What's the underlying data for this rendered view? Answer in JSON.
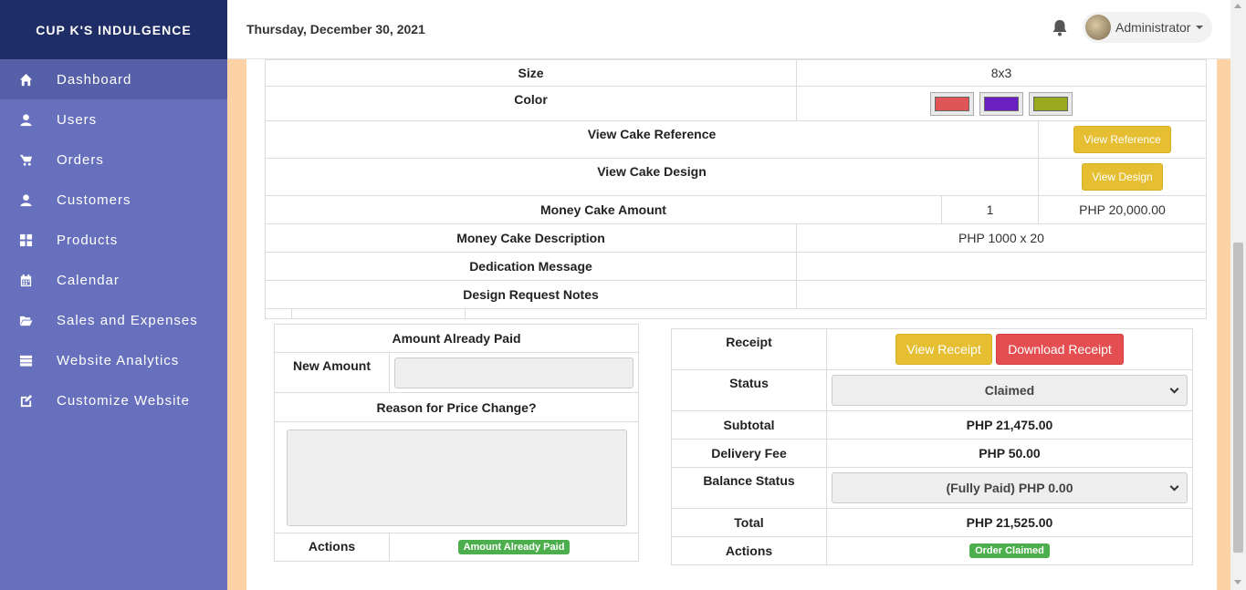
{
  "brand": "CUP K'S INDULGENCE",
  "sidebar": {
    "items": [
      {
        "label": "Dashboard",
        "icon": "home-icon"
      },
      {
        "label": "Users",
        "icon": "user-icon"
      },
      {
        "label": "Orders",
        "icon": "cart-icon"
      },
      {
        "label": "Customers",
        "icon": "user-icon"
      },
      {
        "label": "Products",
        "icon": "grid-icon"
      },
      {
        "label": "Calendar",
        "icon": "calendar-icon"
      },
      {
        "label": "Sales and Expenses",
        "icon": "folder-open-icon"
      },
      {
        "label": "Website Analytics",
        "icon": "server-icon"
      },
      {
        "label": "Customize Website",
        "icon": "edit-icon"
      }
    ]
  },
  "topbar": {
    "date": "Thursday, December 30, 2021",
    "user": "Administrator"
  },
  "details": {
    "size_label": "Size",
    "size_value": "8x3",
    "color_label": "Color",
    "colors": [
      "#e05555",
      "#6a1fc2",
      "#9aaa1e"
    ],
    "reference_label": "View Cake Reference",
    "reference_button": "View Reference",
    "design_label": "View Cake Design",
    "design_button": "View Design",
    "money_amount_label": "Money Cake Amount",
    "money_amount_qty": "1",
    "money_amount_value": "PHP 20,000.00",
    "money_desc_label": "Money Cake Description",
    "money_desc_value": "PHP 1000 x 20",
    "dedication_label": "Dedication Message",
    "dedication_value": "",
    "notes_label": "Design Request Notes",
    "notes_value": ""
  },
  "price_change": {
    "title": "Amount Already Paid",
    "new_amount_label": "New Amount",
    "new_amount_value": "",
    "reason_label": "Reason for Price Change?",
    "reason_value": "",
    "actions_label": "Actions",
    "actions_badge": "Amount Already Paid"
  },
  "summary": {
    "receipt_label": "Receipt",
    "view_receipt": "View Receipt",
    "download_receipt": "Download Receipt",
    "status_label": "Status",
    "status_value": "Claimed",
    "subtotal_label": "Subtotal",
    "subtotal_value": "PHP 21,475.00",
    "delivery_label": "Delivery Fee",
    "delivery_value": "PHP 50.00",
    "balance_label": "Balance Status",
    "balance_value": "(Fully Paid) PHP 0.00",
    "total_label": "Total",
    "total_value": "PHP 21,525.00",
    "actions_label": "Actions",
    "actions_badge": "Order Claimed"
  }
}
